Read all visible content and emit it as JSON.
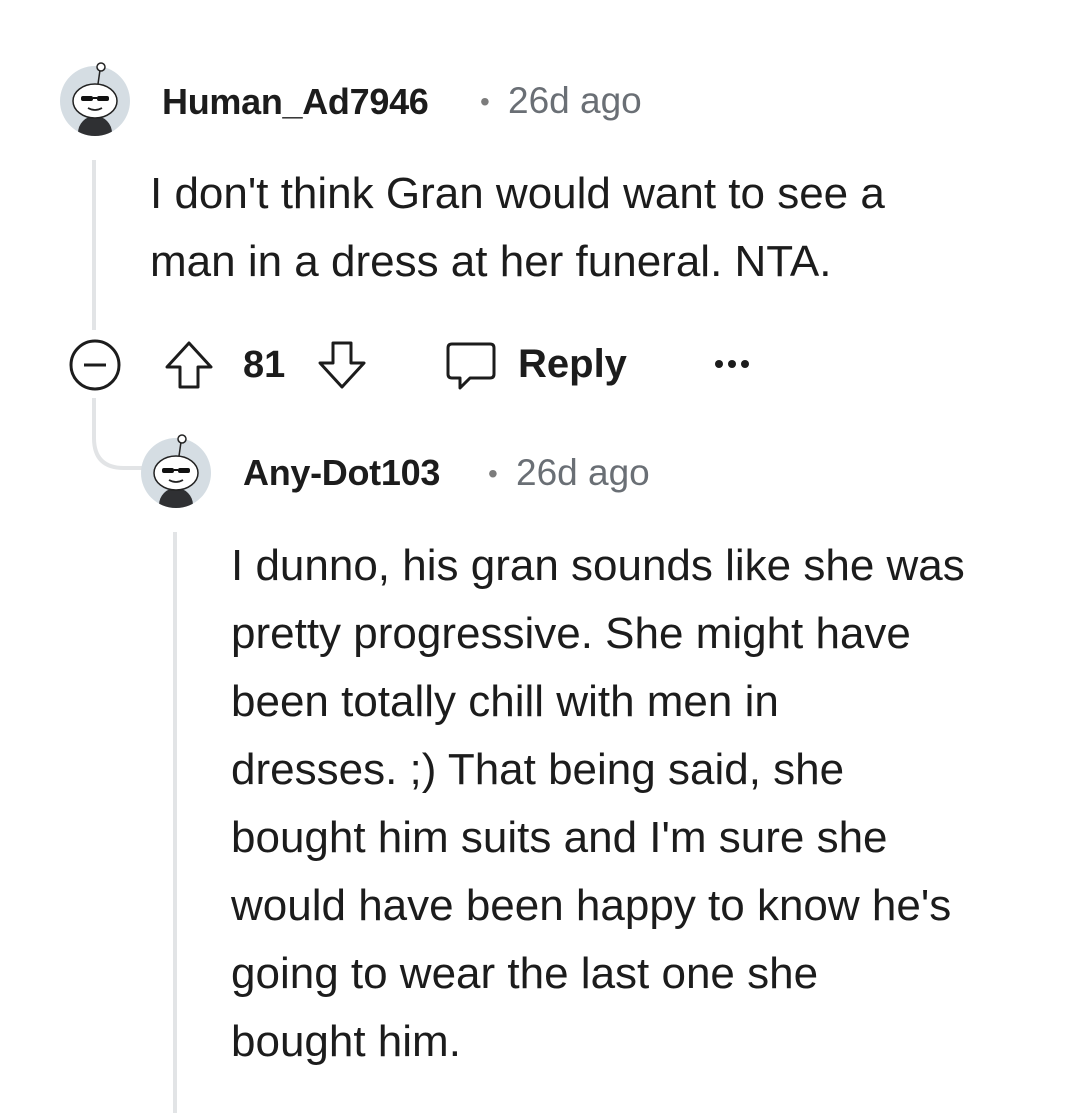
{
  "comment": {
    "username": "Human_Ad7946",
    "separator": "•",
    "timestamp": "26d ago",
    "body_lines": [
      "I don't think Gran would want to see a",
      "man in a dress at her funeral. NTA."
    ],
    "actions": {
      "collapse_icon": "collapse-minus-icon",
      "upvote_icon": "upvote-arrow-icon",
      "vote_count": "81",
      "downvote_icon": "downvote-arrow-icon",
      "reply_icon": "speech-bubble-icon",
      "reply_label": "Reply",
      "more_icon": "more-ellipsis-icon",
      "more_label": "•••"
    }
  },
  "reply": {
    "username": "Any-Dot103",
    "separator": "•",
    "timestamp": "26d ago",
    "body_lines": [
      "I dunno, his gran sounds like she was",
      "pretty progressive. She might have",
      "been totally chill with men in",
      "dresses. ;) That being said, she",
      "bought him suits and I'm sure she",
      "would have been happy to know he's",
      "going to wear the last one she",
      "bought him."
    ]
  },
  "colors": {
    "text": "#1c1c1c",
    "meta": "#6a6f75",
    "thread_line": "#e2e4e6",
    "avatar_bg": "#d5dde3"
  }
}
